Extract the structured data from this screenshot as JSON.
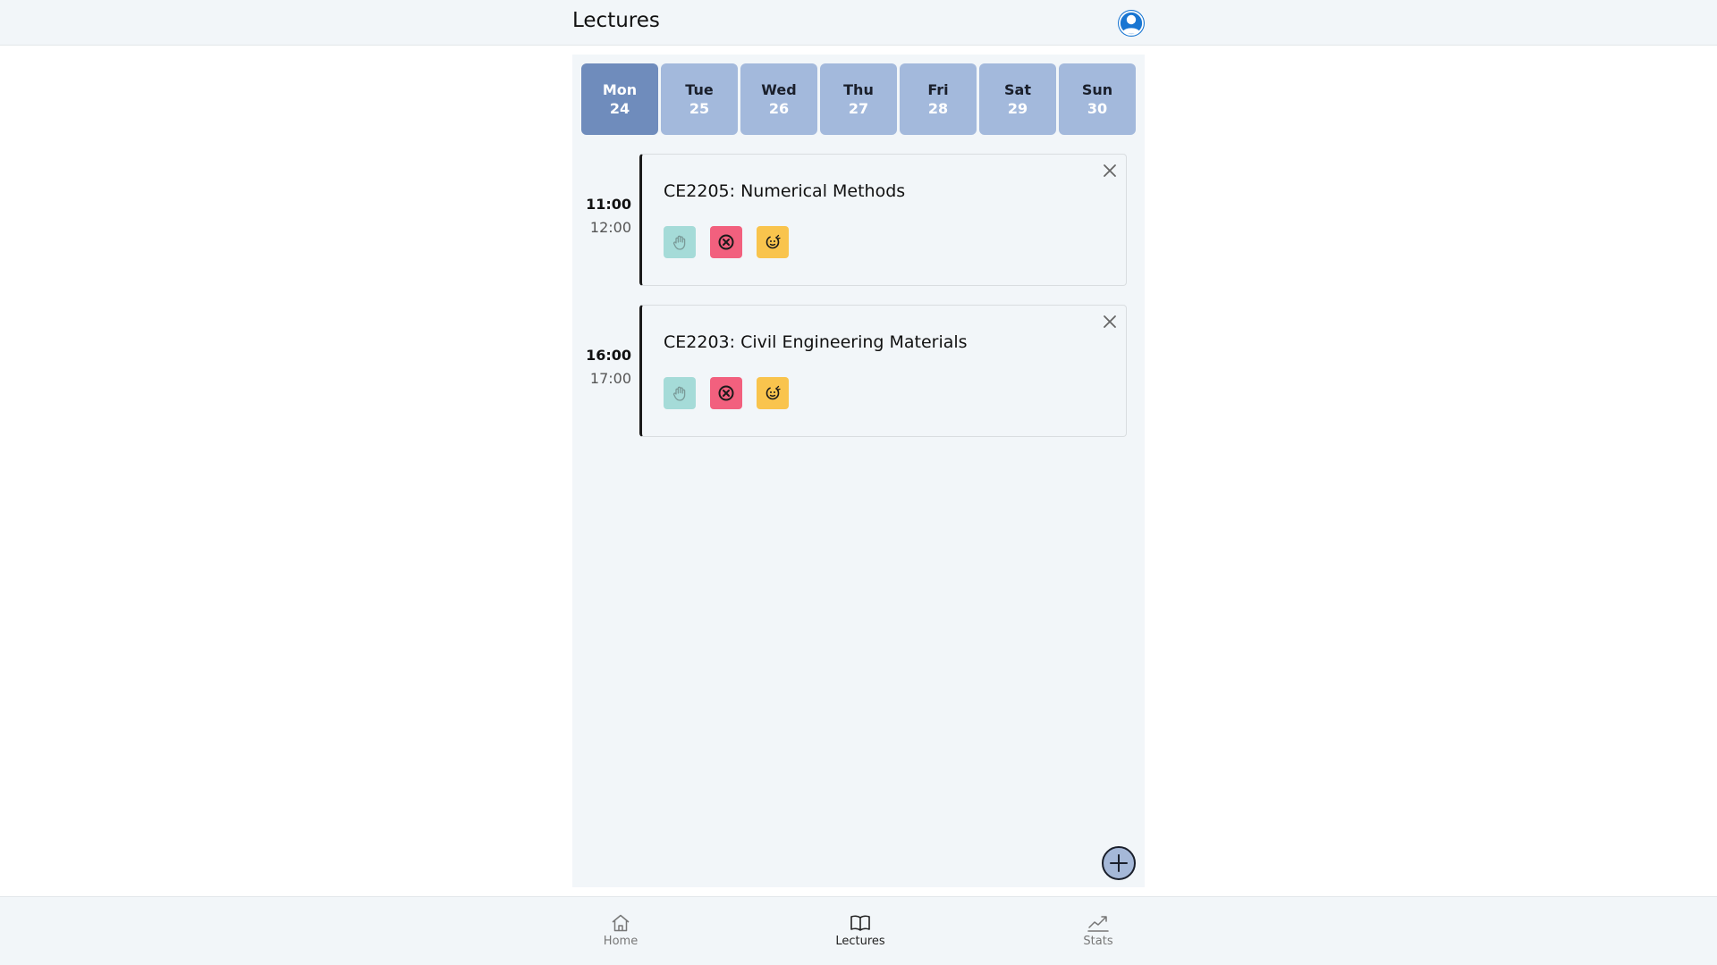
{
  "header": {
    "title": "Lectures",
    "profile_icon": "user-circle-icon"
  },
  "colors": {
    "accent": "#1976d2",
    "day_active": "#6f8cbc",
    "day_inactive": "#a3b9dc",
    "present": "#a5dbd8",
    "absent": "#f2607e",
    "cancelled": "#f9c44d"
  },
  "days": [
    {
      "name": "Mon",
      "num": "24",
      "active": true
    },
    {
      "name": "Tue",
      "num": "25",
      "active": false
    },
    {
      "name": "Wed",
      "num": "26",
      "active": false
    },
    {
      "name": "Thu",
      "num": "27",
      "active": false
    },
    {
      "name": "Fri",
      "num": "28",
      "active": false
    },
    {
      "name": "Sat",
      "num": "29",
      "active": false
    },
    {
      "name": "Sun",
      "num": "30",
      "active": false
    }
  ],
  "lectures": [
    {
      "start": "11:00",
      "end": "12:00",
      "title": "CE2205: Numerical Methods"
    },
    {
      "start": "16:00",
      "end": "17:00",
      "title": "CE2203: Civil Engineering Materials"
    }
  ],
  "actions": {
    "present_icon": "hand-icon",
    "absent_icon": "x-circle-icon",
    "cancel_icon": "cancelled-icon"
  },
  "fab": {
    "icon": "plus-icon"
  },
  "nav": [
    {
      "label": "Home",
      "icon": "home-icon",
      "active": false
    },
    {
      "label": "Lectures",
      "icon": "book-icon",
      "active": true
    },
    {
      "label": "Stats",
      "icon": "trend-icon",
      "active": false
    }
  ]
}
